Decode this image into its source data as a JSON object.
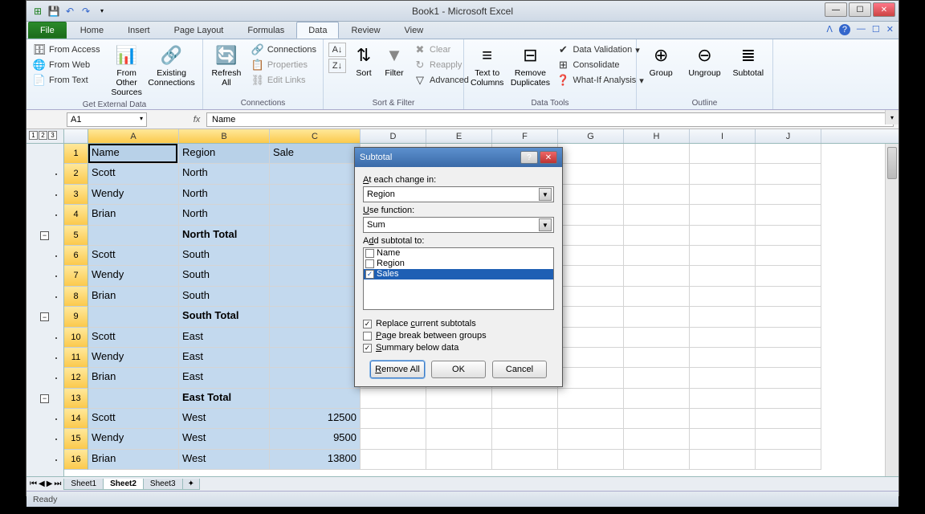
{
  "window": {
    "title": "Book1 - Microsoft Excel",
    "min": "—",
    "max": "☐",
    "close": "✕"
  },
  "tabs": {
    "file": "File",
    "home": "Home",
    "insert": "Insert",
    "page_layout": "Page Layout",
    "formulas": "Formulas",
    "data": "Data",
    "review": "Review",
    "view": "View"
  },
  "ribbon": {
    "get_external": {
      "label": "Get External Data",
      "from_access": "From Access",
      "from_web": "From Web",
      "from_text": "From Text",
      "from_other": "From Other\nSources",
      "existing": "Existing\nConnections"
    },
    "connections": {
      "label": "Connections",
      "refresh": "Refresh\nAll",
      "conn": "Connections",
      "props": "Properties",
      "edit_links": "Edit Links"
    },
    "sortfilter": {
      "label": "Sort & Filter",
      "sort": "Sort",
      "filter": "Filter",
      "clear": "Clear",
      "reapply": "Reapply",
      "advanced": "Advanced"
    },
    "datatools": {
      "label": "Data Tools",
      "ttc": "Text to\nColumns",
      "remdup": "Remove\nDuplicates",
      "validation": "Data Validation",
      "consolidate": "Consolidate",
      "whatif": "What-If Analysis"
    },
    "outline": {
      "label": "Outline",
      "group": "Group",
      "ungroup": "Ungroup",
      "subtotal": "Subtotal"
    }
  },
  "namebox": "A1",
  "formula": "Name",
  "columns": [
    "A",
    "B",
    "C",
    "D",
    "E",
    "F",
    "G",
    "H",
    "I",
    "J"
  ],
  "rows": [
    {
      "n": 1,
      "a": "Name",
      "b": "Region",
      "c": "Sale",
      "hdr": true
    },
    {
      "n": 2,
      "a": "Scott",
      "b": "North",
      "c": ""
    },
    {
      "n": 3,
      "a": "Wendy",
      "b": "North",
      "c": ""
    },
    {
      "n": 4,
      "a": "Brian",
      "b": "North",
      "c": ""
    },
    {
      "n": 5,
      "a": "",
      "b": "North Total",
      "c": "",
      "bold": true,
      "minus": true
    },
    {
      "n": 6,
      "a": "Scott",
      "b": "South",
      "c": ""
    },
    {
      "n": 7,
      "a": "Wendy",
      "b": "South",
      "c": ""
    },
    {
      "n": 8,
      "a": "Brian",
      "b": "South",
      "c": ""
    },
    {
      "n": 9,
      "a": "",
      "b": "South Total",
      "c": "",
      "bold": true,
      "minus": true
    },
    {
      "n": 10,
      "a": "Scott",
      "b": "East",
      "c": ""
    },
    {
      "n": 11,
      "a": "Wendy",
      "b": "East",
      "c": ""
    },
    {
      "n": 12,
      "a": "Brian",
      "b": "East",
      "c": ""
    },
    {
      "n": 13,
      "a": "",
      "b": "East Total",
      "c": "",
      "bold": true,
      "minus": true
    },
    {
      "n": 14,
      "a": "Scott",
      "b": "West",
      "c": "12500"
    },
    {
      "n": 15,
      "a": "Wendy",
      "b": "West",
      "c": "9500"
    },
    {
      "n": 16,
      "a": "Brian",
      "b": "West",
      "c": "13800"
    }
  ],
  "sheets": {
    "s1": "Sheet1",
    "s2": "Sheet2",
    "s3": "Sheet3"
  },
  "status": "Ready",
  "dialog": {
    "title": "Subtotal",
    "at_each": "At each change in:",
    "at_each_val": "Region",
    "use_func": "Use function:",
    "use_func_val": "Sum",
    "add_to": "Add subtotal to:",
    "items": {
      "name": "Name",
      "region": "Region",
      "sales": "Sales"
    },
    "replace": "Replace current subtotals",
    "pagebreak": "Page break between groups",
    "summary": "Summary below data",
    "remove": "Remove All",
    "ok": "OK",
    "cancel": "Cancel"
  }
}
